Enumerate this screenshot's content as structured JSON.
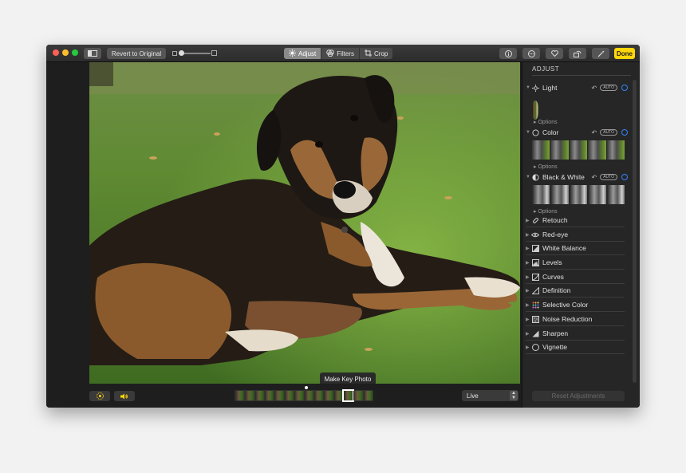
{
  "toolbar": {
    "revert_label": "Revert to Original",
    "tabs": [
      {
        "label": "Adjust",
        "active": true
      },
      {
        "label": "Filters",
        "active": false
      },
      {
        "label": "Crop",
        "active": false
      }
    ],
    "done_label": "Done",
    "icons": [
      "sidebar-toggle-icon",
      "info-icon",
      "more-icon",
      "heart-icon",
      "rotate-icon",
      "wand-icon"
    ]
  },
  "photo": {
    "subject": "dog-on-grass",
    "tooltip": "Make Key Photo"
  },
  "bottom": {
    "live_label": "Live",
    "icons": [
      "live-photo-icon",
      "speaker-icon"
    ]
  },
  "sidebar": {
    "title": "ADJUST",
    "sections": [
      {
        "label": "Light",
        "auto": "AUTO",
        "options": "Options"
      },
      {
        "label": "Color",
        "auto": "AUTO",
        "options": "Options"
      },
      {
        "label": "Black & White",
        "auto": "AUTO",
        "options": "Options"
      }
    ],
    "items": [
      {
        "label": "Retouch"
      },
      {
        "label": "Red-eye"
      },
      {
        "label": "White Balance"
      },
      {
        "label": "Levels"
      },
      {
        "label": "Curves"
      },
      {
        "label": "Definition"
      },
      {
        "label": "Selective Color"
      },
      {
        "label": "Noise Reduction"
      },
      {
        "label": "Sharpen"
      },
      {
        "label": "Vignette"
      }
    ],
    "reset_label": "Reset Adjustments"
  },
  "colors": {
    "accent": "#ffd60a",
    "toggle_ring": "#2f86ff",
    "window_bg": "#1e1e1e",
    "sidebar_bg": "#262626"
  }
}
